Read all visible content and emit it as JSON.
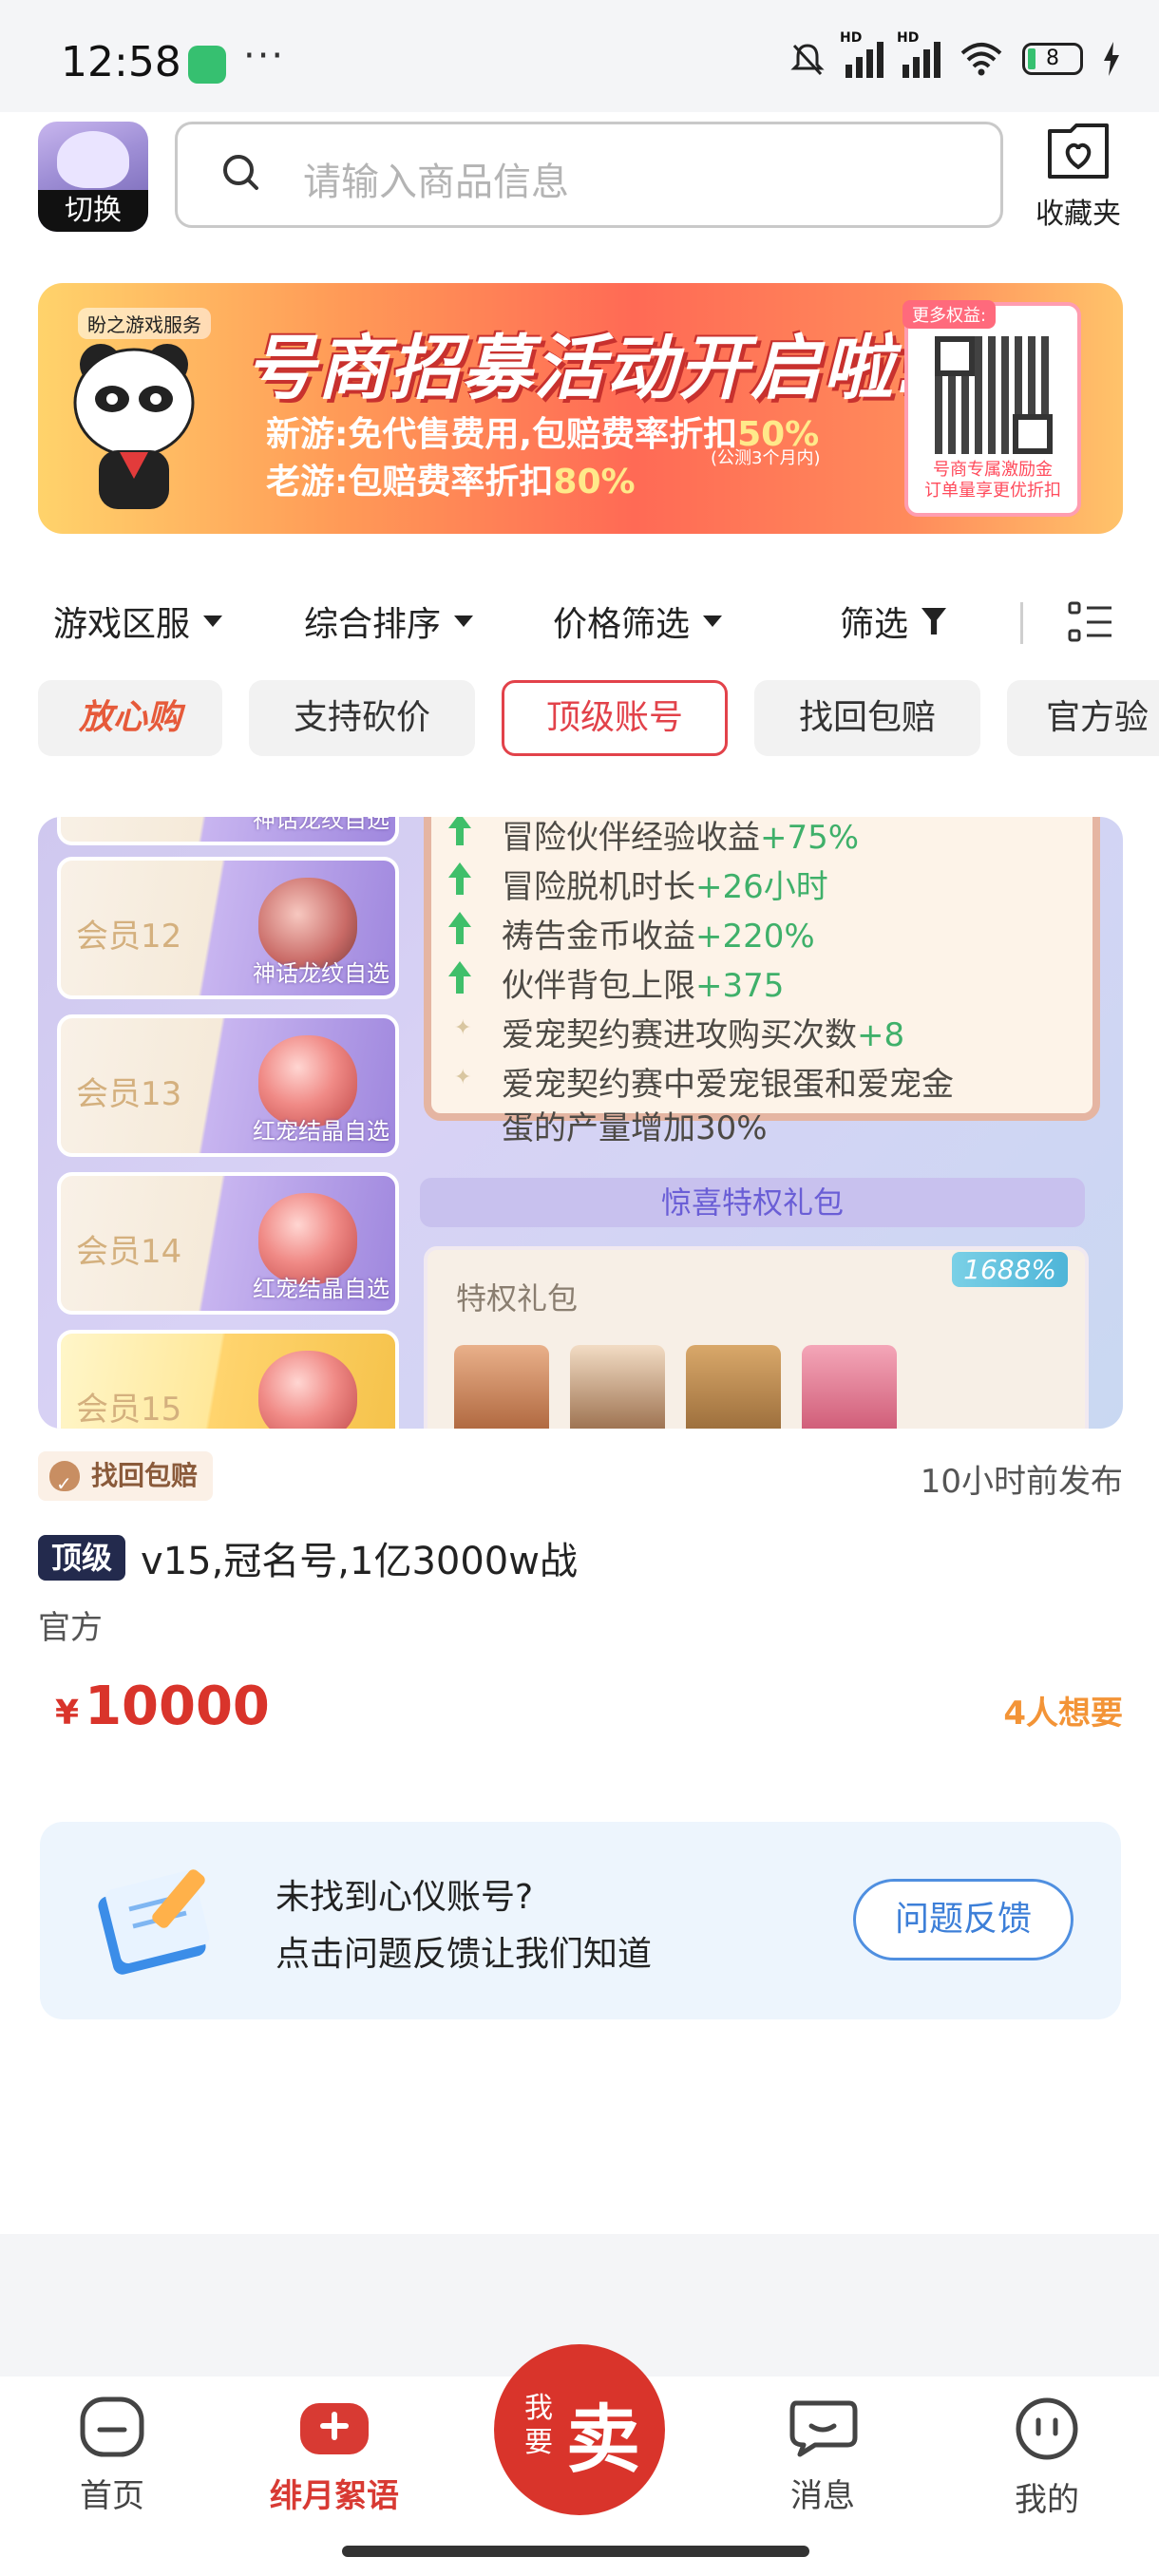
{
  "status_bar": {
    "time": "12:58",
    "more": "···",
    "battery": "8",
    "network": "HD"
  },
  "header": {
    "avatar_label": "切换",
    "search_placeholder": "请输入商品信息",
    "favorites_label": "收藏夹"
  },
  "banner": {
    "brand": "盼之游戏服务",
    "title": "号商招募活动开启啦!",
    "line1_prefix": "新游:免代售费用,包赔费率折扣",
    "line1_value": "50%",
    "line2_prefix": "老游:包赔费率折扣",
    "line2_value": "80%",
    "note": "(公测3个月内)",
    "qr_top": "更多权益:",
    "qr_caption_1": "号商专属激励金",
    "qr_caption_2": "订单量享更优折扣"
  },
  "filters": [
    {
      "label": "游戏区服",
      "icon": "caret-down-icon"
    },
    {
      "label": "综合排序",
      "icon": "caret-down-icon"
    },
    {
      "label": "价格筛选",
      "icon": "caret-down-icon"
    },
    {
      "label": "筛选",
      "icon": "funnel-icon"
    }
  ],
  "tags": [
    "放心购",
    "支持砍价",
    "顶级账号",
    "找回包赔",
    "官方验"
  ],
  "active_tag": "顶级账号",
  "listing": {
    "image": {
      "tiers": [
        {
          "name": "",
          "caption": "神话龙纹自选"
        },
        {
          "name": "会员12",
          "caption": "神话龙纹自选"
        },
        {
          "name": "会员13",
          "caption": "红宠结晶自选"
        },
        {
          "name": "会员14",
          "caption": "红宠结晶自选"
        },
        {
          "name": "会员15",
          "caption": ""
        }
      ],
      "perks": [
        {
          "text": "冒险伙伴经验收益",
          "value": "+75%"
        },
        {
          "text": "冒险脱机时长",
          "value": "+26小时"
        },
        {
          "text": "祷告金币收益",
          "value": "+220%"
        },
        {
          "text": "伙伴背包上限",
          "value": "+375"
        },
        {
          "text": "爱宠契约赛进攻购买次数",
          "value": "+8"
        },
        {
          "text": "爱宠契约赛中爱宠银蛋和爱宠金",
          "value": ""
        },
        {
          "text": "蛋的产量增加30%",
          "value": ""
        }
      ],
      "gift_header": "惊喜特权礼包",
      "gift_title": "特权礼包",
      "gift_badge": "1688%"
    },
    "guarantee_badge": "找回包赔",
    "post_time": "10小时前发布",
    "tier_badge": "顶级",
    "title": "v15,冠名号,1亿3000w战",
    "seller": "官方",
    "currency": "¥",
    "price": "10000",
    "want_count": "4人想要"
  },
  "feedback": {
    "line1": "未找到心仪账号?",
    "line2": "点击问题反馈让我们知道",
    "button": "问题反馈"
  },
  "tabbar": {
    "home": "首页",
    "game": "绯月絮语",
    "sell_small": "我要",
    "sell_big": "卖",
    "messages": "消息",
    "mine": "我的"
  },
  "colors": {
    "accent": "#d9342b",
    "tier_badge": "#232a4d",
    "feedback_blue": "#4f8fe0"
  }
}
